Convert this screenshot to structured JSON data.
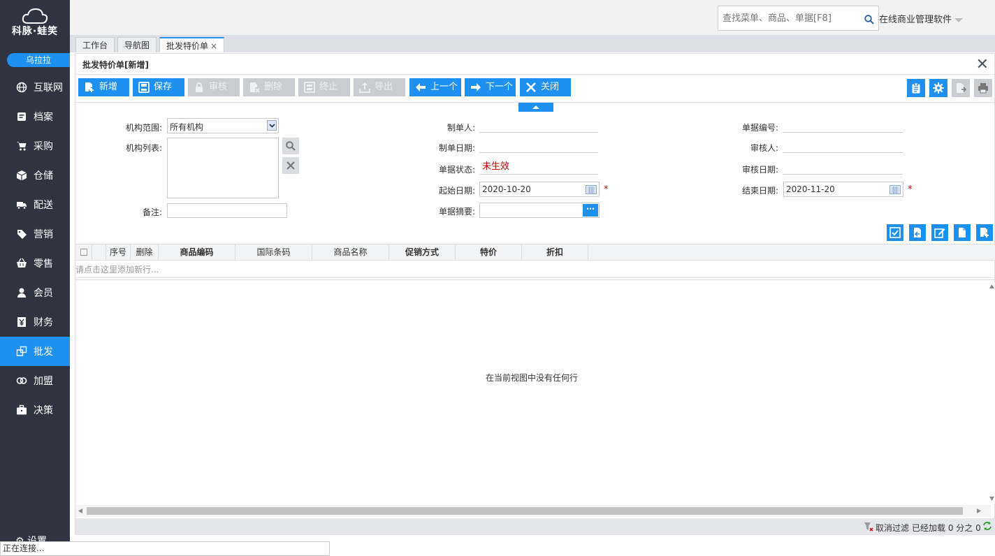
{
  "brand": {
    "name": "科脉·蛙笑",
    "user": "乌拉拉"
  },
  "nav": [
    {
      "label": "互联网",
      "icon": "globe-icon"
    },
    {
      "label": "档案",
      "icon": "archive-icon"
    },
    {
      "label": "采购",
      "icon": "cart-icon"
    },
    {
      "label": "仓储",
      "icon": "box-icon"
    },
    {
      "label": "配送",
      "icon": "truck-icon"
    },
    {
      "label": "营销",
      "icon": "tag-icon"
    },
    {
      "label": "零售",
      "icon": "basket-icon"
    },
    {
      "label": "会员",
      "icon": "person-icon"
    },
    {
      "label": "财务",
      "icon": "yen-icon"
    },
    {
      "label": "批发",
      "icon": "wholesale-icon",
      "active": true
    },
    {
      "label": "加盟",
      "icon": "rings-icon"
    },
    {
      "label": "决策",
      "icon": "briefcase-icon"
    }
  ],
  "settings_label": "设置",
  "topbar": {
    "search_placeholder": "查找菜单、商品、单据[F8]",
    "app_name": "在线商业管理软件"
  },
  "tabs": [
    {
      "label": "工作台"
    },
    {
      "label": "导航图"
    },
    {
      "label": "批发特价单",
      "active": true,
      "closable": "×"
    }
  ],
  "panel": {
    "title": "批发特价单[新增]"
  },
  "toolbar": {
    "new": "新增",
    "save": "保存",
    "approve": "审核",
    "delete": "删除",
    "stop": "终止",
    "export": "导出",
    "prev": "上一个",
    "next": "下一个",
    "close": "关闭"
  },
  "form": {
    "org_scope_label": "机构范围:",
    "org_scope_value": "所有机构",
    "org_list_label": "机构列表:",
    "remark_label": "备注:",
    "maker_label": "制单人:",
    "make_date_label": "制单日期:",
    "status_label": "单据状态:",
    "status_value": "未生效",
    "start_date_label": "起始日期:",
    "start_date_value": "2020-10-20",
    "summary_label": "单据摘要:",
    "doc_no_label": "单据编号:",
    "approver_label": "审核人:",
    "approve_date_label": "审核日期:",
    "end_date_label": "结束日期:",
    "end_date_value": "2020-11-20",
    "required_mark": "*"
  },
  "grid": {
    "columns": [
      "序号",
      "删除",
      "商品编码",
      "国际条码",
      "商品名称",
      "促销方式",
      "特价",
      "折扣"
    ],
    "new_row_hint": "请点击这里添加新行...",
    "empty_text": "在当前视图中没有任何行"
  },
  "statusbar": {
    "cancel_filter": "取消过滤",
    "loaded": "已经加载 0 分之 0"
  },
  "connection": "正在连接..."
}
